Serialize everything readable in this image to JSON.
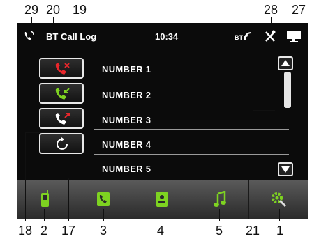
{
  "callouts": {
    "c29": "29",
    "c20": "20",
    "c19": "19",
    "c28": "28",
    "c27": "27",
    "c18": "18",
    "c2": "2",
    "c17": "17",
    "c3": "3",
    "c4": "4",
    "c5": "5",
    "c21": "21",
    "c1": "1"
  },
  "statusbar": {
    "title": "BT Call Log",
    "time": "10:34",
    "bt_label": "BT"
  },
  "rows": [
    {
      "label": "NUMBER 1"
    },
    {
      "label": "NUMBER 2"
    },
    {
      "label": "NUMBER 3"
    },
    {
      "label": "NUMBER 4"
    },
    {
      "label": "NUMBER 5"
    }
  ],
  "icons": {
    "missed_call": "missed-call-icon",
    "received_call": "received-call-icon",
    "dialed_call": "dialed-call-icon",
    "refresh": "refresh-icon",
    "phone": "phone-icon",
    "contacts": "contacts-icon",
    "phonebook": "phonebook-icon",
    "music": "music-icon",
    "settings": "settings-icon"
  },
  "colors": {
    "accent_green": "#7ed321",
    "missed_red": "#e8262b",
    "screen_bg": "#0b0b0b"
  }
}
